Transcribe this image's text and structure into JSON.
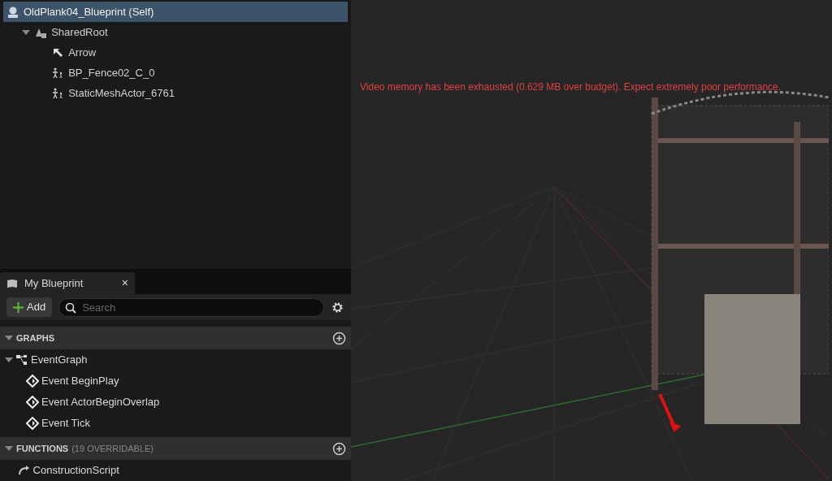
{
  "components": [
    {
      "label": "OldPlank04_Blueprint (Self)",
      "kind": "self",
      "selected": true
    },
    {
      "label": "SharedRoot",
      "kind": "root",
      "selected": false,
      "expanded": true,
      "children": [
        {
          "label": "Arrow",
          "kind": "arrow",
          "selected": false
        },
        {
          "label": "BP_Fence02_C_0",
          "kind": "actor",
          "selected": false
        },
        {
          "label": "StaticMeshActor_6761",
          "kind": "actor",
          "selected": false
        }
      ]
    }
  ],
  "my_blueprint": {
    "tab": {
      "label": "My Blueprint",
      "close": "×"
    },
    "add_button": "Add",
    "search": {
      "placeholder": "Search"
    },
    "sections": [
      {
        "title": "GRAPHS",
        "expanded": true,
        "items": [
          {
            "label": "EventGraph",
            "kind": "graph",
            "expanded": true,
            "children": [
              {
                "label": "Event BeginPlay",
                "kind": "event"
              },
              {
                "label": "Event ActorBeginOverlap",
                "kind": "event"
              },
              {
                "label": "Event Tick",
                "kind": "event"
              }
            ]
          }
        ]
      },
      {
        "title": "FUNCTIONS",
        "note": "(19 OVERRIDABLE)",
        "expanded": true,
        "items": [
          {
            "label": "ConstructionScript",
            "kind": "function"
          }
        ]
      }
    ]
  },
  "viewport": {
    "warning": "Video memory has been exhausted (0.629 MB over budget). Expect extremely poor performance."
  }
}
